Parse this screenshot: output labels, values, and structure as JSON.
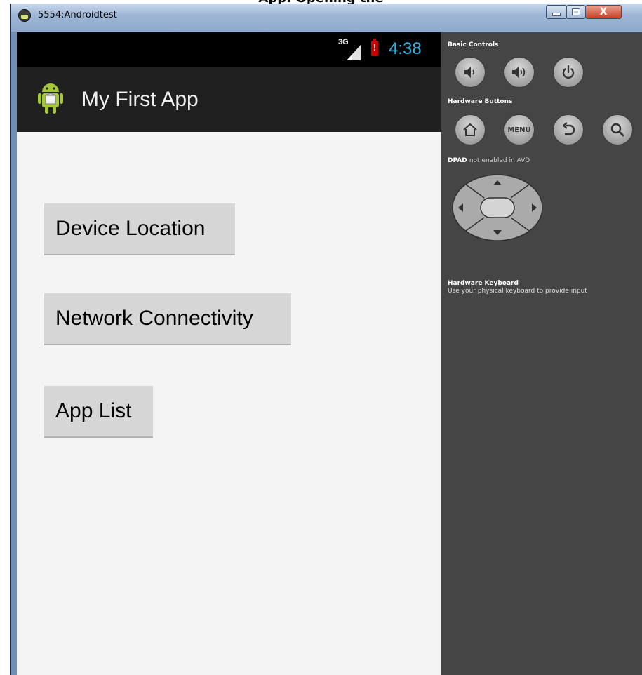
{
  "top_crop_text": "App: Opening the",
  "window": {
    "title": "5554:Androidtest",
    "close_label": "X"
  },
  "device": {
    "status": {
      "network_type": "3G",
      "time": "4:38"
    },
    "action_bar": {
      "title": "My First App"
    },
    "buttons": [
      {
        "label": "Device Location"
      },
      {
        "label": "Network Connectivity"
      },
      {
        "label": "App List"
      }
    ]
  },
  "controls": {
    "basic_controls_label": "Basic Controls",
    "hardware_buttons_label": "Hardware Buttons",
    "menu_label": "MENU",
    "dpad_label_bold": "DPAD",
    "dpad_label_rest": "not enabled in AVD",
    "keyboard_title": "Hardware Keyboard",
    "keyboard_desc": "Use your physical keyboard to provide input"
  },
  "icons": [
    "android-emulator-icon",
    "minimize-icon",
    "maximize-icon",
    "close-icon",
    "signal-icon",
    "battery-icon",
    "android-app-icon",
    "volume-down-icon",
    "volume-up-icon",
    "power-icon",
    "home-icon",
    "back-icon",
    "search-icon",
    "dpad"
  ]
}
